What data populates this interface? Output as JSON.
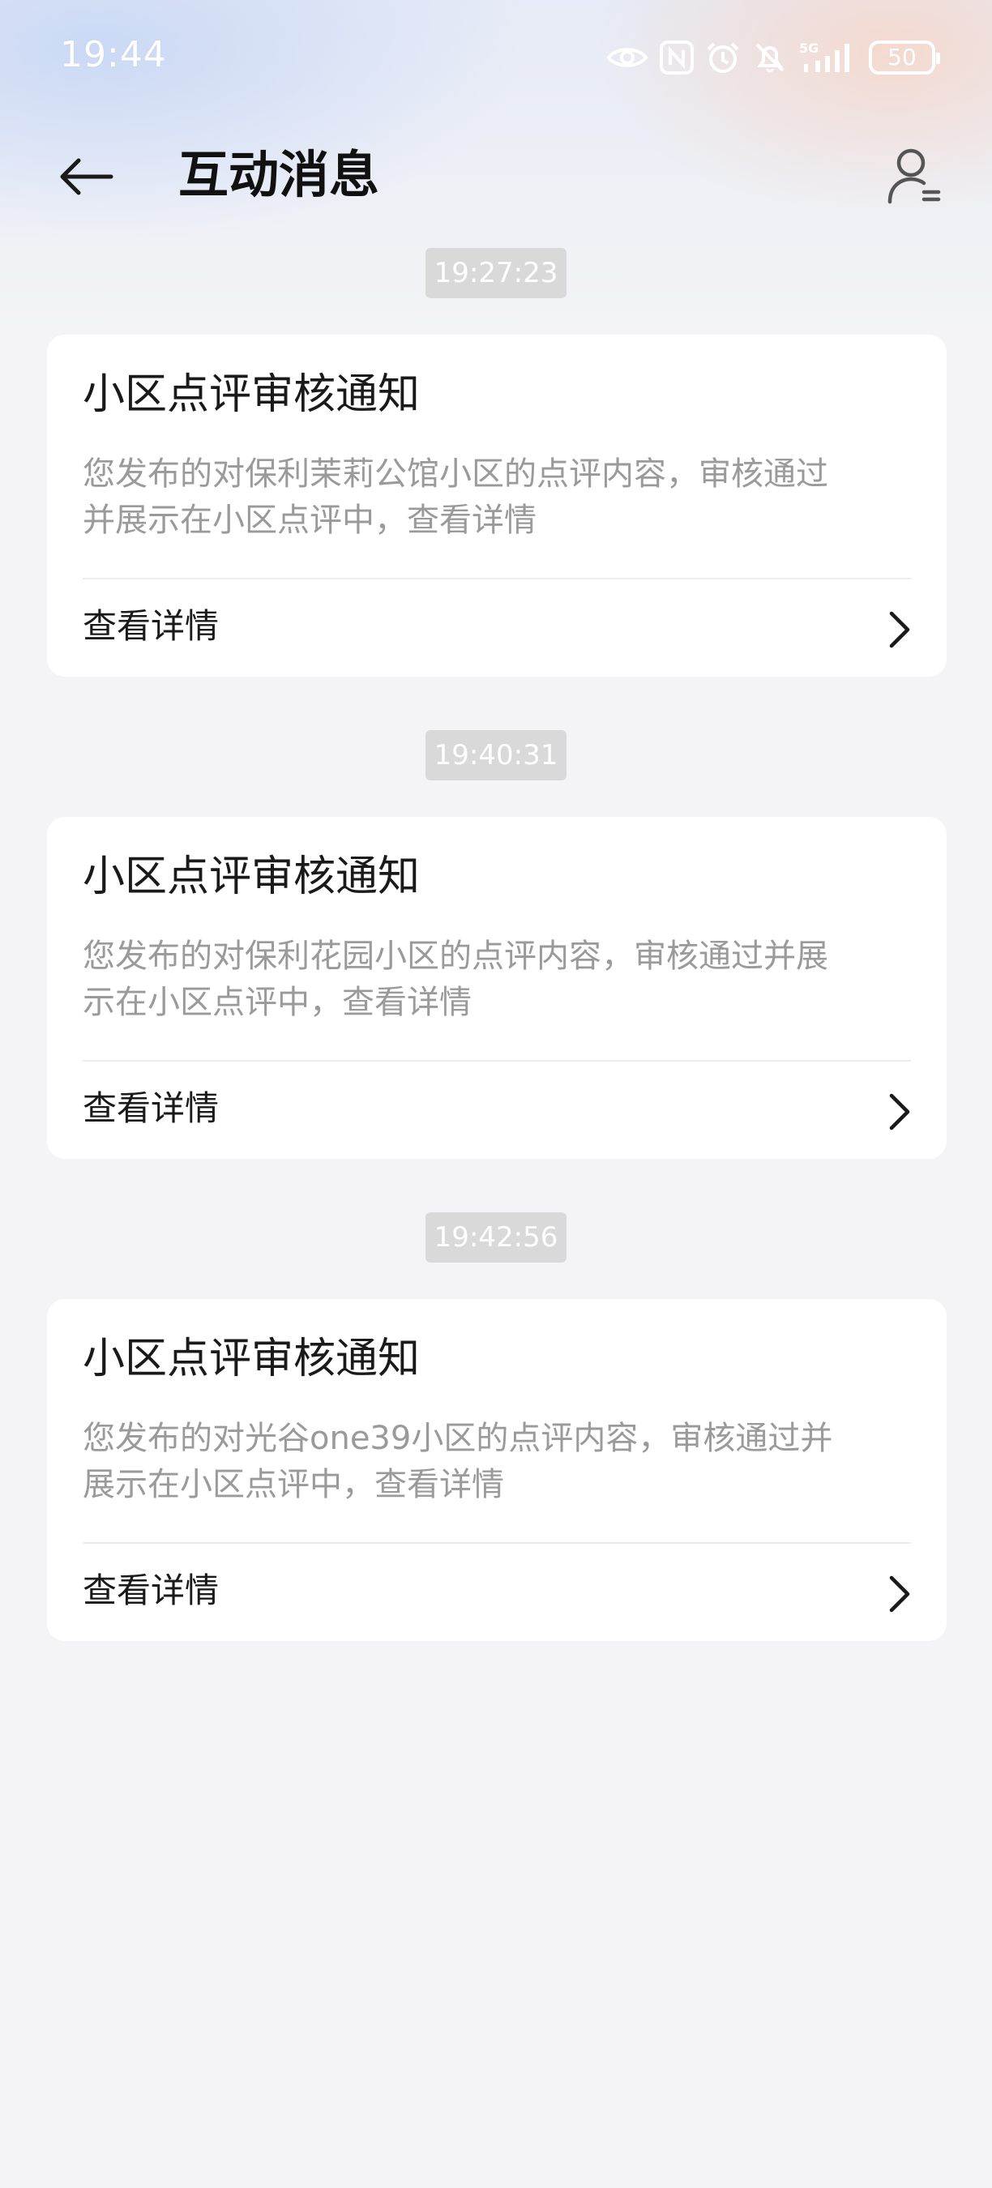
{
  "status_bar": {
    "time": "19:44",
    "icons": [
      "eye-icon",
      "nfc-icon",
      "alarm-icon",
      "mute-icon",
      "signal-5g-icon",
      "battery-icon"
    ],
    "network_label": "5G",
    "battery_level": "50"
  },
  "header": {
    "title": "互动消息",
    "back_icon": "arrow-left-icon",
    "profile_icon": "user-list-icon"
  },
  "messages": [
    {
      "time": "19:27:23",
      "title": "小区点评审核通知",
      "body_line1": "您发布的对保利茉莉公馆小区的点评内容，审核通过",
      "body_line2": "并展示在小区点评中，查看详情",
      "action": "查看详情"
    },
    {
      "time": "19:40:31",
      "title": "小区点评审核通知",
      "body_line1": "您发布的对保利花园小区的点评内容，审核通过并展",
      "body_line2": "示在小区点评中，查看详情",
      "action": "查看详情"
    },
    {
      "time": "19:42:56",
      "title": "小区点评审核通知",
      "body_line1": "您发布的对光谷one39小区的点评内容，审核通过并",
      "body_line2": "展示在小区点评中，查看详情",
      "action": "查看详情"
    }
  ],
  "colors": {
    "background": "#f4f4f6",
    "card": "#ffffff",
    "title_text": "#1a1a1a",
    "body_text": "#9a9a9a",
    "time_chip": "#d9d9da"
  }
}
